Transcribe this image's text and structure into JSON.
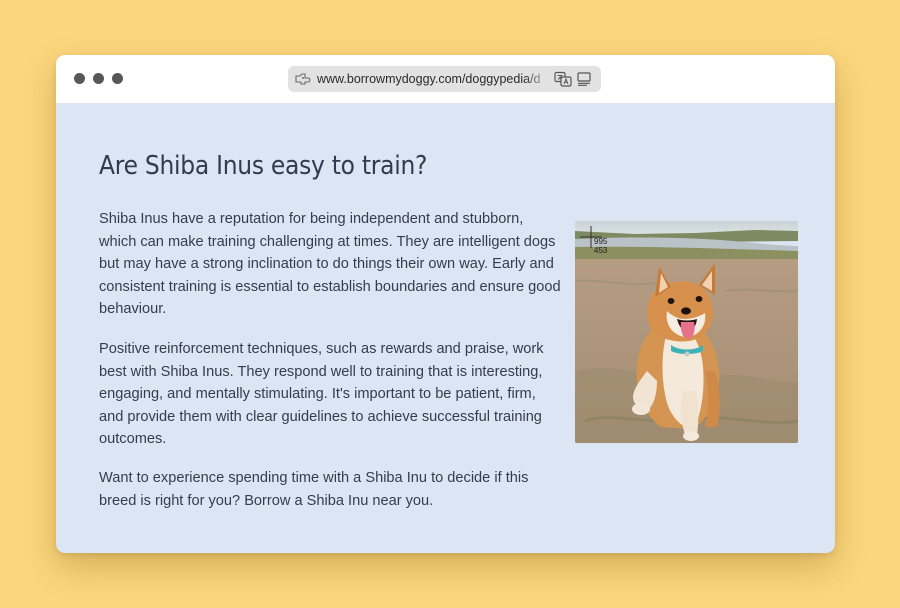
{
  "browser": {
    "url": "www.borrowmydoggy.com/doggypedia/d",
    "window_controls": [
      "close",
      "minimize",
      "zoom"
    ],
    "icons": {
      "site": "tag-icon",
      "translate": "translate-icon",
      "reader": "reader-mode-icon"
    }
  },
  "article": {
    "title": "Are Shiba Inus easy to train?",
    "paragraphs": [
      "Shiba Inus have a reputation for being independent and stubborn, which can make training challenging at times. They are intelligent dogs but may have a strong inclination to do things their own way. Early and consistent training is essential to establish boundaries and ensure good behaviour.",
      "Positive reinforcement techniques, such as rewards and praise, work best with Shiba Inus. They respond well to training that is interesting, engaging, and mentally stimulating. It's important to be patient, firm, and provide them with clear guidelines to achieve successful training outcomes.",
      "Want to experience spending time with a Shiba Inu to decide if this breed is right for you? Borrow a Shiba Inu near you."
    ],
    "photo": {
      "subject": "shiba-inu-sitting-in-field",
      "coords_overlay": [
        "995",
        "453"
      ]
    }
  },
  "colors": {
    "background": "#fbd67c",
    "page": "#dbe5f3",
    "text": "#363c4c",
    "title": "#333a4e"
  }
}
